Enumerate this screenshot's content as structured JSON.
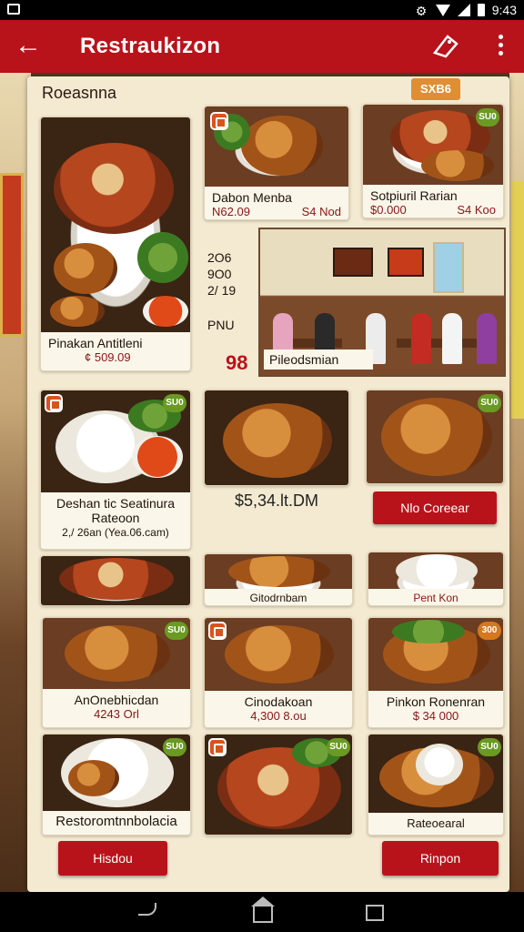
{
  "status_bar": {
    "time": "9:43"
  },
  "app_bar": {
    "title": "Restraukizon"
  },
  "panel": {
    "title": "Roeasnna",
    "badge": "SXB6"
  },
  "side_stats": {
    "line1": "2O6",
    "line2": "9O0",
    "line3": "2/ 19",
    "line4": "PNU",
    "red_number": "98"
  },
  "photo": {
    "caption": "Pileodsmian"
  },
  "cards": {
    "main": {
      "name": "Pinakan Antitleni",
      "price": "¢ 509.09"
    },
    "c1": {
      "name": "Dabon Menba",
      "price_left": "N62.09",
      "price_right": "S4 Nod"
    },
    "c2": {
      "name": "Sotpiuril Rarian",
      "price_left": "$0.000",
      "price_right": "S4 Koo",
      "badge": "SU0"
    },
    "r2a": {
      "name": "Deshan tic Seatinura",
      "name2": "Rateoon",
      "price": "2,/ 26an (Yea.06.cam)",
      "badge": "SU0"
    },
    "r2b": {
      "price": "$5,34.lt.DM"
    },
    "r2c": {
      "badge": "SU0",
      "button": "Nlo Coreear"
    },
    "r3a": {},
    "r3b": {
      "name": "Gitodrnbam"
    },
    "r3c": {
      "name": "Pent Kon"
    },
    "r4a": {
      "name": "AnOnebhicdan",
      "price": "4243 Orl",
      "badge": "SU0"
    },
    "r4b": {
      "name": "Cinodakoan",
      "price": "4,300 8.ou"
    },
    "r4c": {
      "name": "Pinkon Ronenran",
      "price": "$ 34 000",
      "badge": "300"
    },
    "r5a": {
      "name": "Restoromtnnbolacia",
      "badge": "SU0"
    },
    "r5b": {
      "badge": "SU0"
    },
    "r5c": {
      "name": "Rateoearal",
      "badge": "SU0"
    }
  },
  "buttons": {
    "left": "Hisdou",
    "right": "Rinpon"
  },
  "colors": {
    "primary": "#b8131b",
    "panel": "#f4ead2",
    "price": "#8a1515"
  }
}
